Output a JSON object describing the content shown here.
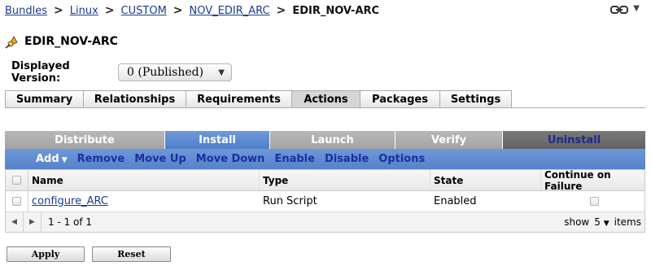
{
  "breadcrumb": [
    "Bundles",
    "Linux",
    "CUSTOM",
    "NOV_EDIR_ARC"
  ],
  "breadcrumb_current": "EDIR_NOV-ARC",
  "page": {
    "title": "EDIR_NOV-ARC"
  },
  "version": {
    "label": "Displayed Version:",
    "value": "0 (Published)"
  },
  "tabs": [
    "Summary",
    "Relationships",
    "Requirements",
    "Actions",
    "Packages",
    "Settings"
  ],
  "active_tab": "Actions",
  "subtabs": [
    "Distribute",
    "Install",
    "Launch",
    "Verify",
    "Uninstall"
  ],
  "active_subtab": "Install",
  "toolbar": {
    "add": "Add",
    "remove": "Remove",
    "move_up": "Move Up",
    "move_down": "Move Down",
    "enable": "Enable",
    "disable": "Disable",
    "options": "Options"
  },
  "table": {
    "columns": [
      "Name",
      "Type",
      "State",
      "Continue on Failure"
    ],
    "rows": [
      {
        "name": "configure_ARC",
        "type": "Run Script",
        "state": "Enabled",
        "continue_on_failure": false
      }
    ]
  },
  "pager": {
    "range": "1 - 1 of 1",
    "show_label": "show",
    "page_size": "5",
    "items_label": "items"
  },
  "buttons": {
    "apply": "Apply",
    "reset": "Reset"
  },
  "colors": {
    "accent_blue": "#5582c9",
    "link": "#1a3b8f",
    "tab_gray": "#a3a3a3",
    "uninstall_tab": "#626262"
  }
}
